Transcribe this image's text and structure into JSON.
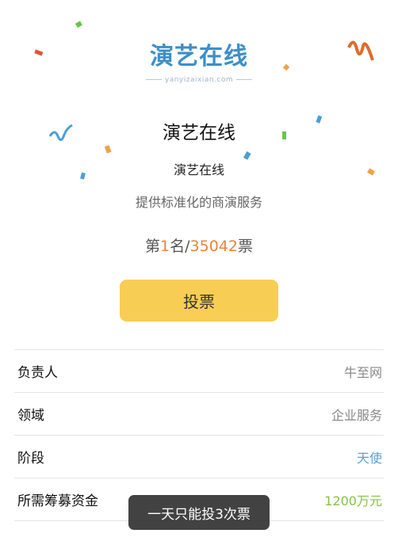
{
  "logo": {
    "text": "演艺在线",
    "subtext": "yanyizaixian.com"
  },
  "project": {
    "title": "演艺在线",
    "subtitle": "演艺在线",
    "description": "提供标准化的商演服务"
  },
  "ranking": {
    "prefix": "第",
    "rank": "1",
    "middle": "名/",
    "votes": "35042",
    "suffix": "票"
  },
  "vote_button": {
    "label": "投票"
  },
  "info": [
    {
      "label": "负责人",
      "value": "牛至网"
    },
    {
      "label": "领域",
      "value": "企业服务"
    },
    {
      "label": "阶段",
      "value": "天使"
    },
    {
      "label": "所需筹募资金",
      "value": "1200万元"
    }
  ],
  "toast": {
    "text": "一天只能投3次票"
  },
  "colors": {
    "accent_yellow": "#f8cd54",
    "rank_orange": "#e8843c",
    "stage_blue": "#5b9fd6",
    "funding_green": "#86c24a",
    "logo_blue": "#3c8fc7"
  }
}
